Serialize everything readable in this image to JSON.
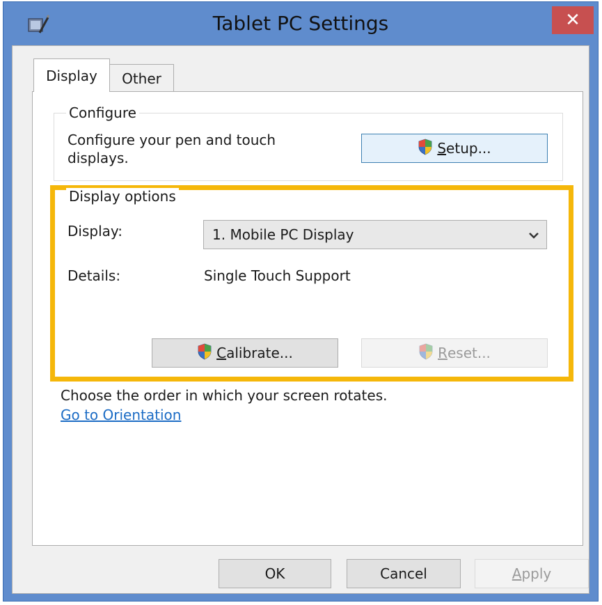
{
  "window": {
    "title": "Tablet PC Settings",
    "close_label": "✕",
    "app_icon": "tablet-pc-icon"
  },
  "tabs": [
    {
      "label": "Display",
      "selected": true
    },
    {
      "label": "Other",
      "selected": false
    }
  ],
  "configure": {
    "legend": "Configure",
    "description": "Configure your pen and touch displays.",
    "setup_button": {
      "label": "Setup...",
      "accel": "S",
      "rest": "etup...",
      "icon": "uac-shield-icon"
    }
  },
  "display_options": {
    "legend": "Display options",
    "display_label": "Display:",
    "display_value": "1. Mobile PC Display",
    "details_label": "Details:",
    "details_value": "Single Touch Support",
    "calibrate_button": {
      "label": "Calibrate...",
      "accel": "C",
      "rest": "alibrate...",
      "icon": "uac-shield-icon"
    },
    "reset_button": {
      "label": "Reset...",
      "accel": "R",
      "rest": "eset...",
      "icon": "uac-shield-icon",
      "enabled": false
    },
    "highlight_color": "#f5b70a"
  },
  "orientation": {
    "text": "Choose the order in which your screen rotates.",
    "link": "Go to Orientation"
  },
  "footer": {
    "ok": "OK",
    "cancel": "Cancel",
    "apply": "Apply",
    "apply_accel": "A",
    "apply_rest": "pply",
    "apply_enabled": false
  },
  "colors": {
    "title_bar": "#5f8ccd",
    "close_button": "#c75050",
    "link": "#1c6cc5"
  }
}
